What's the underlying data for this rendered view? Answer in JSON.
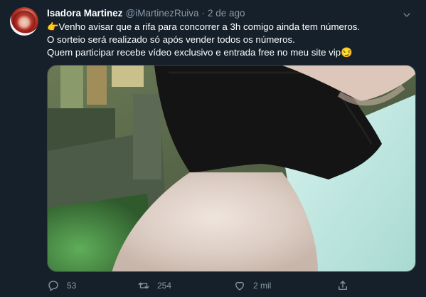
{
  "tweet": {
    "display_name": "Isadora Martinez",
    "handle": "@iMartinezRuiva",
    "separator": "·",
    "date": "2 de ago",
    "text_lines": [
      "👉Venho avisar que a rifa para concorrer a 3h comigo ainda tem números.",
      "O sorteio será realizado só após vender todos os números.",
      "Quem participar recebe vídeo exclusivo e entrada free no meu site vip😏"
    ]
  },
  "actions": {
    "reply_count": "53",
    "retweet_count": "254",
    "like_count": "2 mil"
  },
  "icons": {
    "more": "chevron-down-icon",
    "reply": "reply-icon",
    "retweet": "retweet-icon",
    "like": "heart-icon",
    "share": "share-icon"
  },
  "colors": {
    "background": "#15202b",
    "secondary_text": "#8899a6",
    "border": "#38444d"
  }
}
